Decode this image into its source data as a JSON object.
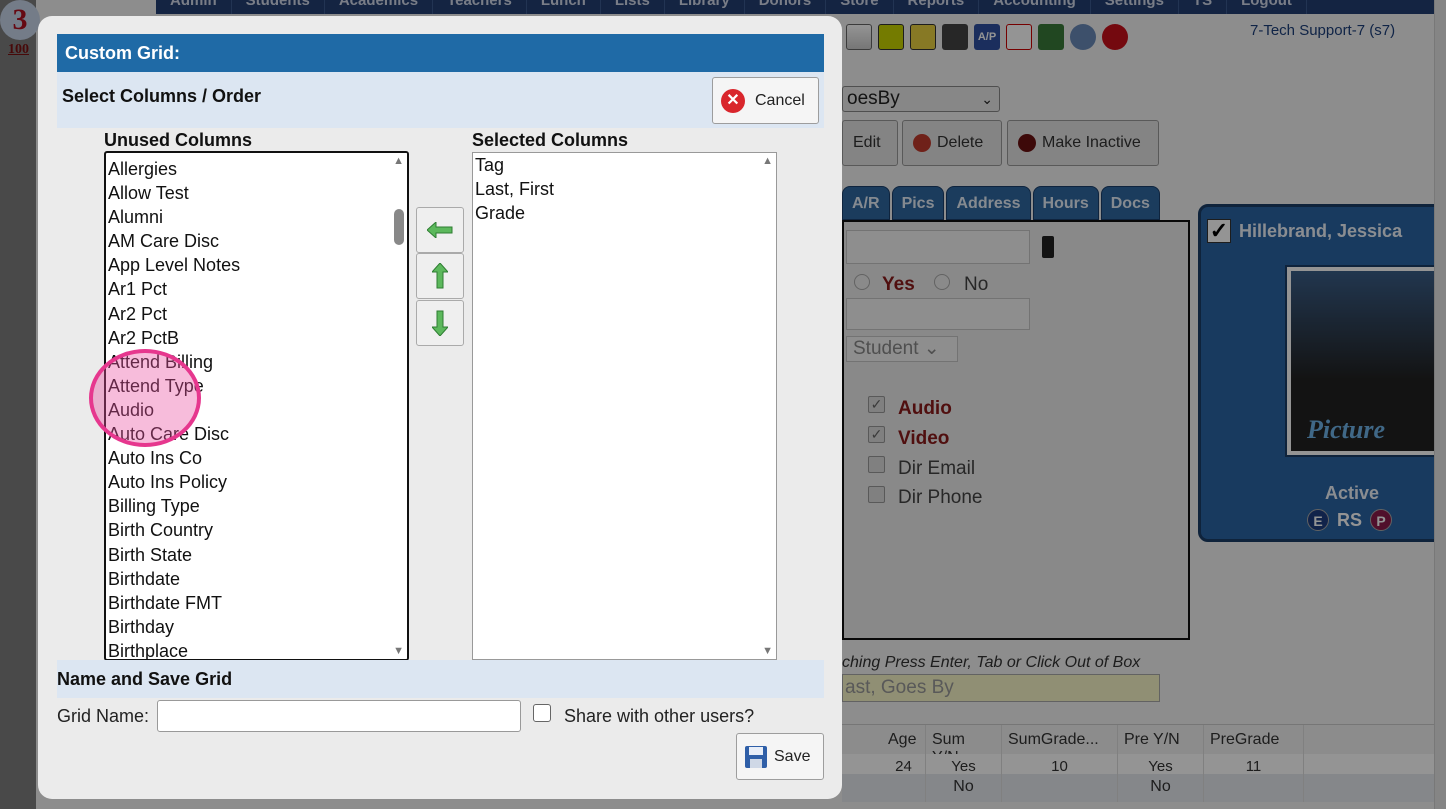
{
  "background": {
    "logo_text": "100",
    "top_nav": [
      "Admin",
      "Students",
      "Academics",
      "Teachers",
      "Lunch",
      "Lists",
      "Library",
      "Donors",
      "Store",
      "Reports",
      "Accounting",
      "Settings",
      "TS",
      "Logout"
    ],
    "toolbar_icons": [
      "grid-icon",
      "card-icon",
      "id-card-icon",
      "printer-icon",
      "ap-icon",
      "pdf-icon",
      "money-icon",
      "help-icon",
      "power-icon"
    ],
    "ap_icon_text": "A/P",
    "user": "7-Tech Support-7 (s7)",
    "goes_by_select": "oesBy",
    "buttons": {
      "edit": "Edit",
      "delete": "Delete",
      "make_inactive": "Make Inactive"
    },
    "tabs": [
      "A/R",
      "Pics",
      "Address",
      "Hours",
      "Docs"
    ],
    "form": {
      "yes_label": "Yes",
      "no_label": "No",
      "role_select": "Student",
      "audio_label": "Audio",
      "video_label": "Video",
      "dir_email_label": "Dir Email",
      "dir_phone_label": "Dir Phone"
    },
    "card": {
      "name": "Hillebrand, Jessica",
      "picture_label": "Picture",
      "status": "Active",
      "badge_e": "E",
      "badge_rs": "RS",
      "badge_p": "P"
    },
    "search_hint": "ching Press Enter, Tab or Click Out of Box",
    "search_placeholder": "ast, Goes By",
    "grid_headers": [
      "Age",
      "Sum Y/N",
      "SumGrade...",
      "Pre Y/N",
      "PreGrade ..."
    ],
    "grid_row1": [
      "24",
      "Yes",
      "10",
      "Yes",
      "11"
    ],
    "grid_row2": [
      "",
      "No",
      "",
      "No",
      ""
    ]
  },
  "modal": {
    "title": "Custom Grid:",
    "select_section": "Select Columns / Order",
    "cancel_label": "Cancel",
    "unused_label": "Unused Columns",
    "selected_label": "Selected Columns",
    "unused_columns": [
      "Allergies",
      "Allow Test",
      "Alumni",
      "AM Care Disc",
      "App Level Notes",
      "Ar1 Pct",
      "Ar2 Pct",
      "Ar2 PctB",
      "Attend Billing",
      "Attend Type",
      "Audio",
      "Auto Care Disc",
      "Auto Ins Co",
      "Auto Ins Policy",
      "Billing Type",
      "Birth Country",
      "Birth State",
      "Birthdate",
      "Birthdate FMT",
      "Birthday",
      "Birthplace"
    ],
    "selected_columns": [
      "Tag",
      "Last, First",
      "Grade"
    ],
    "name_section": "Name and Save Grid",
    "grid_name_label": "Grid Name:",
    "grid_name_value": "",
    "share_label": "Share with other users?",
    "share_checked": false,
    "save_label": "Save"
  },
  "colors": {
    "title_bar": "#1f6aa6",
    "section_bar": "#dce6f2",
    "highlight": "#e6378e",
    "arrow_green": "#4caf50"
  }
}
